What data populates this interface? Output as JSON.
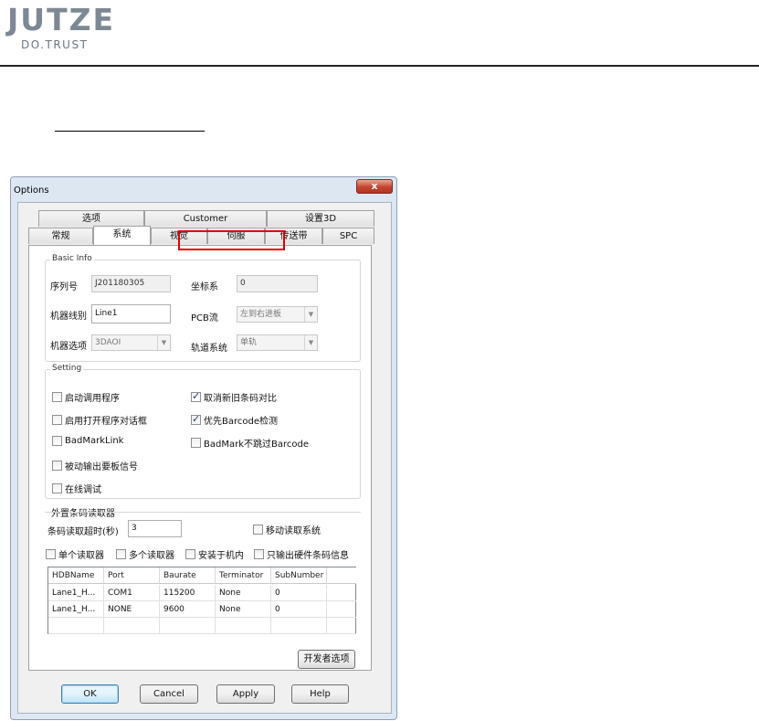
{
  "logo": {
    "wordmark": "JUTZE",
    "tagline": "DO.TRUST"
  },
  "dialog": {
    "title": "Options",
    "close_glyph": "x",
    "tabs_row1": [
      "选项",
      "Customer",
      "设置3D"
    ],
    "tabs_row2": [
      "常规",
      "系统",
      "视觉",
      "伺服",
      "传送带",
      "SPC"
    ],
    "active_tab": "系统",
    "basic_info": {
      "title": "Basic Info",
      "serial_label": "序列号",
      "serial_value": "J201180305",
      "coord_label": "坐标系",
      "coord_value": "0",
      "line_label": "机器线别",
      "line_value": "Line1",
      "pcb_label": "PCB流",
      "pcb_value": "左到右进板",
      "machine_label": "机器选项",
      "machine_value": "3DAOI",
      "track_label": "轨道系统",
      "track_value": "单轨"
    },
    "setting": {
      "title": "Setting",
      "options": [
        {
          "label": "启动调用程序",
          "checked": false
        },
        {
          "label": "取消新旧条码对比",
          "checked": true
        },
        {
          "label": "启用打开程序对话框",
          "checked": false
        },
        {
          "label": "优先Barcode检测",
          "checked": true
        },
        {
          "label": "BadMarkLink",
          "checked": false
        },
        {
          "label": "BadMark不跳过Barcode",
          "checked": false
        },
        {
          "label": "被动输出要板信号",
          "checked": false
        },
        {
          "label": "在线调试",
          "checked": false
        }
      ]
    },
    "barcode": {
      "title": "外置条码读取器",
      "timeout_label": "条码读取超时(秒)",
      "timeout_value": "3",
      "mobile_read": {
        "label": "移动读取系统",
        "checked": false
      },
      "options": [
        {
          "label": "单个读取器",
          "checked": false
        },
        {
          "label": "多个读取器",
          "checked": false
        },
        {
          "label": "安装于机内",
          "checked": false
        },
        {
          "label": "只输出硬件条码信息",
          "checked": false
        }
      ],
      "columns": [
        "HDBName",
        "Port",
        "Baurate",
        "Terminator",
        "SubNumber"
      ],
      "rows": [
        [
          "Lane1_H...",
          "COM1",
          "115200",
          "None",
          "0"
        ],
        [
          "Lane1_H...",
          "NONE",
          "9600",
          "None",
          "0"
        ]
      ]
    },
    "dev_options_label": "开发者选项",
    "buttons": {
      "ok": "OK",
      "cancel": "Cancel",
      "apply": "Apply",
      "help": "Help"
    },
    "colors": {
      "highlight": "#e00000",
      "dialog_frame": "#dde7f2",
      "close_button": "#c4452f"
    }
  }
}
